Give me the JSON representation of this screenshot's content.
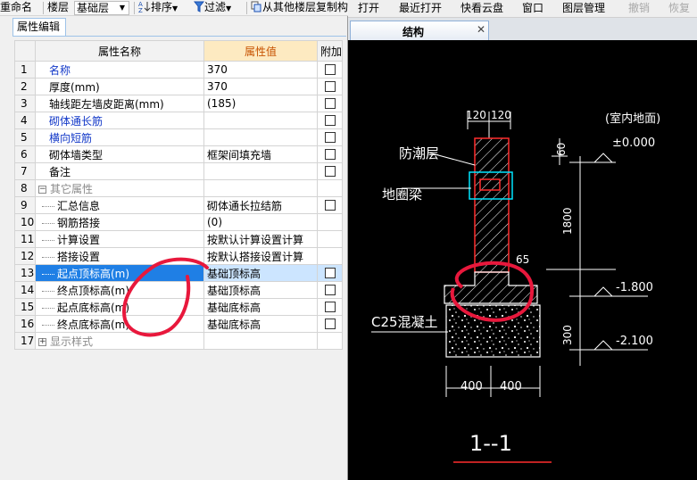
{
  "toolbar": {
    "rename": "重命名",
    "floor_label": "楼层",
    "floor_value": "基础层",
    "sort": "排序",
    "filter": "过滤",
    "copy_from": "从其他楼层复制构"
  },
  "panel": {
    "tab": "属性编辑"
  },
  "grid": {
    "headers": {
      "name": "属性名称",
      "value": "属性值",
      "extra": "附加"
    },
    "rows": [
      {
        "num": "1",
        "name": "名称",
        "value": "370"
      },
      {
        "num": "2",
        "name": "厚度(mm)",
        "value": "370"
      },
      {
        "num": "3",
        "name": "轴线距左墙皮距离(mm)",
        "value": "(185)"
      },
      {
        "num": "4",
        "name": "砌体通长筋",
        "value": ""
      },
      {
        "num": "5",
        "name": "横向短筋",
        "value": ""
      },
      {
        "num": "6",
        "name": "砌体墙类型",
        "value": "框架间填充墙"
      },
      {
        "num": "7",
        "name": "备注",
        "value": ""
      },
      {
        "num": "8",
        "name": "其它属性",
        "value": ""
      },
      {
        "num": "9",
        "name": "汇总信息",
        "value": "砌体通长拉结筋"
      },
      {
        "num": "10",
        "name": "钢筋搭接",
        "value": "(0)"
      },
      {
        "num": "11",
        "name": "计算设置",
        "value": "按默认计算设置计算"
      },
      {
        "num": "12",
        "name": "搭接设置",
        "value": "按默认搭接设置计算"
      },
      {
        "num": "13",
        "name": "起点顶标高(m)",
        "value": "基础顶标高"
      },
      {
        "num": "14",
        "name": "终点顶标高(m)",
        "value": "基础顶标高"
      },
      {
        "num": "15",
        "name": "起点底标高(m)",
        "value": "基础底标高"
      },
      {
        "num": "16",
        "name": "终点底标高(m)",
        "value": "基础底标高"
      },
      {
        "num": "17",
        "name": "显示样式",
        "value": ""
      }
    ]
  },
  "menu": {
    "open": "打开",
    "recent": "最近打开",
    "cloud": "快看云盘",
    "window": "窗口",
    "layers": "图层管理",
    "undo": "撤销",
    "redo": "恢复"
  },
  "doc_tab": {
    "label": "结构",
    "close": "✕"
  },
  "drawing": {
    "dim_120_left": "120",
    "dim_120_right": "120",
    "room_floor": "(室内地面)",
    "elev_0": "±0.000",
    "moisture_layer": "防潮层",
    "dim_60": "60",
    "ring_beam": "地圈梁",
    "dim_1800": "1800",
    "dim_65": "65",
    "elev_1800": "-1.800",
    "concrete": "C25混凝土",
    "dim_300": "300",
    "elev_2100": "-2.100",
    "dim_400_left": "400",
    "dim_400_right": "400",
    "section": "1--1"
  },
  "colors": {
    "selected_row": "#1f7fe5",
    "value_header": "#fdeac1",
    "annotation": "#e8183c",
    "cad_red": "#ff2d2d",
    "cad_cyan": "#00e5ff"
  }
}
